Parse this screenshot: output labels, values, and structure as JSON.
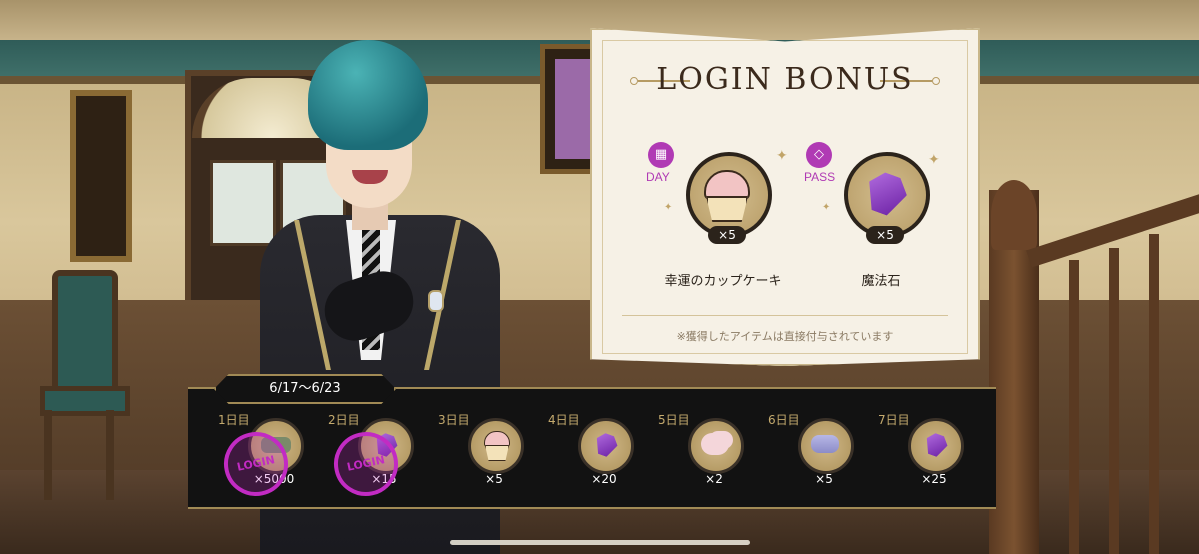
{
  "panel": {
    "title": "LOGIN BONUS",
    "rewards": [
      {
        "badge": "calendar-icon",
        "badge_glyph": "▦",
        "badge_label": "DAY",
        "qty": "×5",
        "name": "幸運のカップケーキ"
      },
      {
        "badge": "diamond-icon",
        "badge_glyph": "◇",
        "badge_label": "PASS",
        "qty": "×5",
        "name": "魔法石"
      }
    ],
    "note": "※獲得したアイテムは直接付与されています"
  },
  "calendar": {
    "date_range": "6/17〜6/23",
    "stamp_text": "LOGIN",
    "days": [
      {
        "label": "1日目",
        "qty": "×5000",
        "claimed": true,
        "icon": "item-icon"
      },
      {
        "label": "2日目",
        "qty": "×15",
        "claimed": true,
        "icon": "gem-icon"
      },
      {
        "label": "3日目",
        "qty": "×5",
        "claimed": false,
        "icon": "cupcake-icon"
      },
      {
        "label": "4日目",
        "qty": "×20",
        "claimed": false,
        "icon": "gem-icon"
      },
      {
        "label": "5日目",
        "qty": "×2",
        "claimed": false,
        "icon": "puff-icon"
      },
      {
        "label": "6日目",
        "qty": "×5",
        "claimed": false,
        "icon": "macaron-icon"
      },
      {
        "label": "7日目",
        "qty": "×25",
        "claimed": false,
        "icon": "gem-icon"
      }
    ]
  },
  "colors": {
    "accent_purple": "#b03ab4",
    "gold": "#a18a55",
    "panel_bg": "#f6f1e6"
  }
}
